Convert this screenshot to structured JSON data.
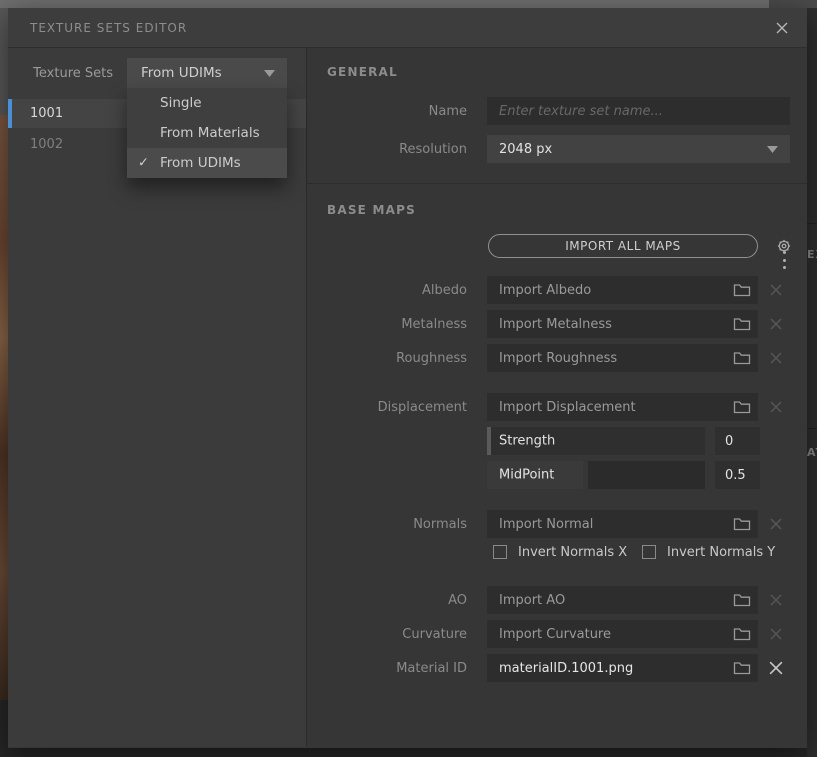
{
  "window": {
    "title": "TEXTURE SETS EDITOR"
  },
  "texture_sets_panel": {
    "label": "Texture Sets",
    "mode_dropdown": {
      "value": "From UDIMs"
    },
    "mode_menu": {
      "items": [
        {
          "label": "Single",
          "checked": false
        },
        {
          "label": "From Materials",
          "checked": false
        },
        {
          "label": "From UDIMs",
          "checked": true
        }
      ]
    },
    "sets": [
      {
        "name": "1001",
        "selected": true
      },
      {
        "name": "1002",
        "selected": false
      }
    ]
  },
  "general": {
    "title": "GENERAL",
    "name": {
      "label": "Name",
      "placeholder": "Enter texture set name..."
    },
    "resolution": {
      "label": "Resolution",
      "value": "2048 px"
    }
  },
  "base_maps": {
    "title": "BASE MAPS",
    "import_all_button": "IMPORT ALL MAPS",
    "albedo": {
      "label": "Albedo",
      "placeholder": "Import Albedo"
    },
    "metalness": {
      "label": "Metalness",
      "placeholder": "Import Metalness"
    },
    "roughness": {
      "label": "Roughness",
      "placeholder": "Import Roughness"
    },
    "displacement": {
      "label": "Displacement",
      "placeholder": "Import Displacement",
      "strength": {
        "label": "Strength",
        "value": "0",
        "fill_pct": 0
      },
      "midpoint": {
        "label": "MidPoint",
        "value": "0.5",
        "fill_pct": 44
      }
    },
    "normals": {
      "label": "Normals",
      "placeholder": "Import Normal",
      "invert_x": "Invert Normals X",
      "invert_y": "Invert Normals Y"
    },
    "ao": {
      "label": "AO",
      "placeholder": "Import AO"
    },
    "curvature": {
      "label": "Curvature",
      "placeholder": "Import Curvature"
    },
    "material_id": {
      "label": "Material ID",
      "value": "materialID.1001.png"
    }
  },
  "background": {
    "fragments": [
      "EX",
      "AT"
    ]
  },
  "colors": {
    "accent_blue": "#4a8fd4",
    "panel": "#363636",
    "field": "#2d2d2d"
  }
}
